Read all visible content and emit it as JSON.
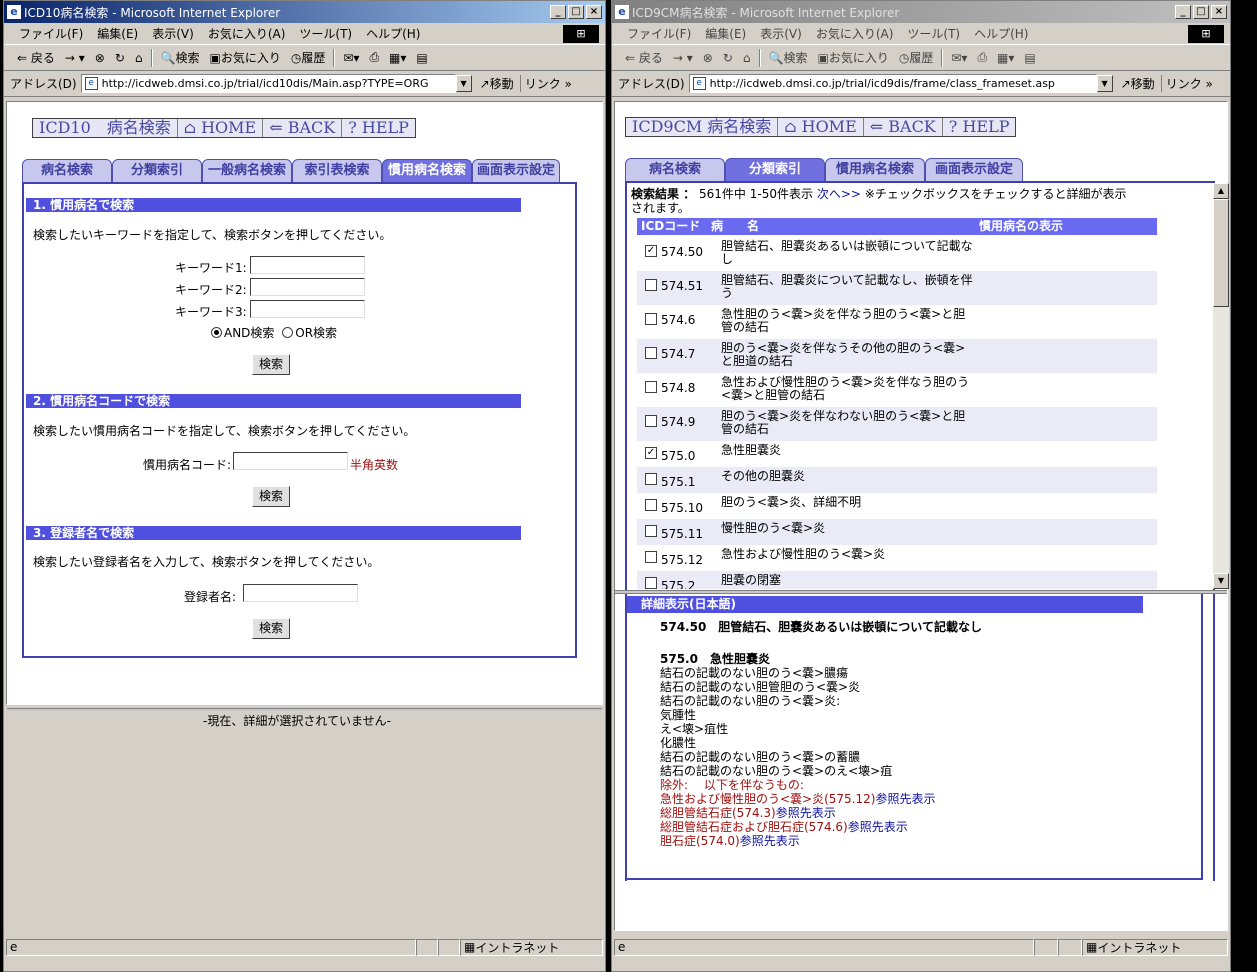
{
  "browser": {
    "menu": [
      "ファイル(F)",
      "編集(E)",
      "表示(V)",
      "お気に入り(A)",
      "ツール(T)",
      "ヘルプ(H)"
    ],
    "toolbar": {
      "back": "⇐ 戻る",
      "search": "検索",
      "favorites": "お気に入り",
      "history": "履歴"
    },
    "address_label": "アドレス(D)",
    "go": "移動",
    "links": "リンク",
    "zone": "イントラネット"
  },
  "left": {
    "title": "ICD10病名検索 - Microsoft Internet Explorer",
    "url": "http://icdweb.dmsi.co.jp/trial/icd10dis/Main.asp?TYPE=ORG",
    "nav": {
      "app": "ICD10　病名検索",
      "home": "HOME",
      "back": "BACK",
      "help": "HELP"
    },
    "tabs": [
      "病名検索",
      "分類索引",
      "一般病名検索",
      "索引表検索",
      "慣用病名検索",
      "画面表示設定"
    ],
    "sec1": {
      "title": "1. 慣用病名で検索",
      "desc": "検索したいキーワードを指定して、検索ボタンを押してください。",
      "kw1": "キーワード1:",
      "kw2": "キーワード2:",
      "kw3": "キーワード3:",
      "and": "AND検索",
      "or": "OR検索",
      "search": "検索"
    },
    "sec2": {
      "title": "2. 慣用病名コードで検索",
      "desc": "検索したい慣用病名コードを指定して、検索ボタンを押してください。",
      "label": "慣用病名コード:",
      "hint": "半角英数",
      "search": "検索"
    },
    "sec3": {
      "title": "3. 登録者名で検索",
      "desc": "検索したい登録者名を入力して、検索ボタンを押してください。",
      "label": "登録者名:",
      "search": "検索"
    },
    "detail_empty": "-現在、詳細が選択されていません-"
  },
  "right": {
    "title": "ICD9CM病名検索 - Microsoft Internet Explorer",
    "url": "http://icdweb.dmsi.co.jp/trial/icd9dis/frame/class_frameset.asp",
    "nav": {
      "app": "ICD9CM 病名検索",
      "home": "HOME",
      "back": "BACK",
      "help": "HELP"
    },
    "tabs": [
      "病名検索",
      "分類索引",
      "慣用病名検索",
      "画面表示設定"
    ],
    "result_label": "検索結果 ：",
    "result_count": "561件中 1-50件表示",
    "next": "次へ>>",
    "result_note": "※チェックボックスをチェックすると詳細が表示",
    "result_note2": "されます。",
    "headers": {
      "code": "ICDコード",
      "name": "病　　名",
      "common": "慣用病名の表示"
    },
    "rows": [
      {
        "code": "574.50",
        "name": "胆管結石、胆嚢炎あるいは嵌頓について記載なし",
        "checked": true
      },
      {
        "code": "574.51",
        "name": "胆管結石、胆嚢炎について記載なし、嵌頓を伴う",
        "checked": false
      },
      {
        "code": "574.6",
        "name": "急性胆のう<嚢>炎を伴なう胆のう<嚢>と胆管の結石",
        "checked": false
      },
      {
        "code": "574.7",
        "name": "胆のう<嚢>炎を伴なうその他の胆のう<嚢>と胆道の結石",
        "checked": false
      },
      {
        "code": "574.8",
        "name": "急性および慢性胆のう<嚢>炎を伴なう胆のう<嚢>と胆管の結石",
        "checked": false
      },
      {
        "code": "574.9",
        "name": "胆のう<嚢>炎を伴なわない胆のう<嚢>と胆管の結石",
        "checked": false
      },
      {
        "code": "575.0",
        "name": "急性胆嚢炎",
        "checked": true
      },
      {
        "code": "575.1",
        "name": "その他の胆嚢炎",
        "checked": false
      },
      {
        "code": "575.10",
        "name": "胆のう<嚢>炎、詳細不明",
        "checked": false
      },
      {
        "code": "575.11",
        "name": "慢性胆のう<嚢>炎",
        "checked": false
      },
      {
        "code": "575.12",
        "name": "急性および慢性胆のう<嚢>炎",
        "checked": false
      },
      {
        "code": "575.2",
        "name": "胆嚢の閉塞",
        "checked": false
      }
    ],
    "detail_title": "詳細表示(日本語)",
    "detail1": "574.50　胆管結石、胆嚢炎あるいは嵌頓について記載なし",
    "detail2": "575.0　急性胆嚢炎",
    "detail_lines": [
      "結石の記載のない胆のう<嚢>膿瘍",
      "結石の記載のない胆管胆のう<嚢>炎",
      "結石の記載のない胆のう<嚢>炎:",
      "気腫性",
      "え<壊>疽性",
      "化膿性",
      "結石の記載のない胆のう<嚢>の蓄膿",
      "結石の記載のない胆のう<嚢>のえ<壊>疽"
    ],
    "exclude_label": "除外:　 以下を伴なうもの:",
    "excludes": [
      {
        "text": "急性および慢性胆のう<嚢>炎(575.12)",
        "link": "参照先表示"
      },
      {
        "text": "総胆管結石症(574.3)",
        "link": "参照先表示"
      },
      {
        "text": "総胆管結石症および胆石症(574.6)",
        "link": "参照先表示"
      },
      {
        "text": "胆石症(574.0)",
        "link": "参照先表示"
      }
    ]
  }
}
